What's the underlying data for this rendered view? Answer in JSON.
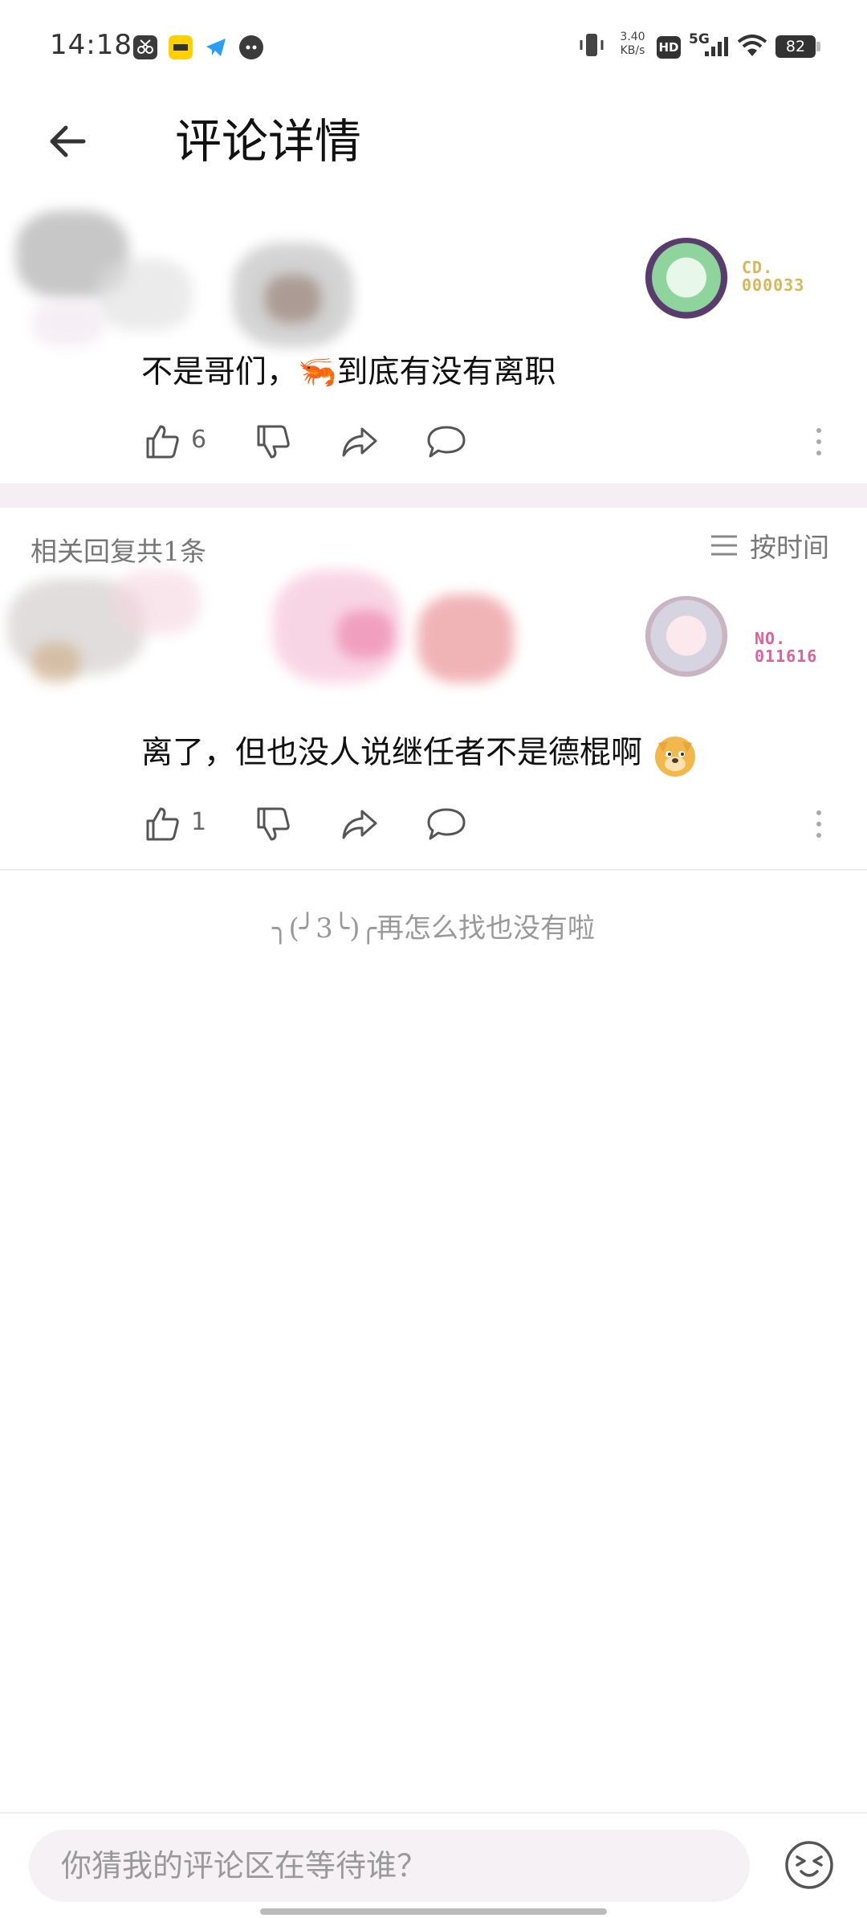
{
  "status_bar": {
    "time": "14:18",
    "net_speed_value": "3.40",
    "net_speed_unit": "KB/s",
    "hd_label": "HD",
    "network_label": "5G",
    "battery": "82",
    "icons": [
      "scissors-app-icon",
      "meituan-app-icon",
      "telegram-app-icon",
      "github-app-icon",
      "vibrate-icon",
      "signal-icon",
      "wifi-icon",
      "battery-icon"
    ]
  },
  "header": {
    "title": "评论详情"
  },
  "main_comment": {
    "fan_number_label": "CD.",
    "fan_number": "000033",
    "text": "不是哥们，🦐到底有没有离职",
    "like_count": "6"
  },
  "replies": {
    "count_label": "相关回复共1条",
    "sort_label": "按时间",
    "items": [
      {
        "fan_number_label": "NO.",
        "fan_number": "011616",
        "text": "离了，但也没人说继任者不是德棍啊",
        "like_count": "1"
      }
    ]
  },
  "end_message": "╮(╯3╰)╭再怎么找也没有啦",
  "composer": {
    "placeholder": "你猜我的评论区在等待谁？"
  },
  "colors": {
    "accent_gold": "#d8b65a",
    "accent_pink": "#e0609c",
    "section_gap": "#f5eff3"
  }
}
